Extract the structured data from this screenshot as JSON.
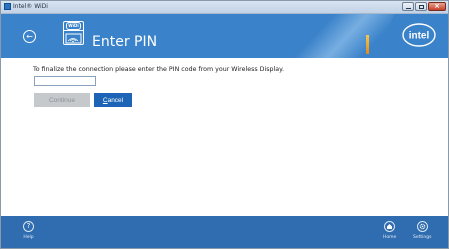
{
  "window": {
    "title": "Intel® WiDi"
  },
  "header": {
    "title": "Enter PIN",
    "widi_logo_text": "WiDi",
    "brand": "intel",
    "colors": {
      "header_blue": "#3a82c9",
      "accent_orange": "#f0a63a"
    }
  },
  "content": {
    "instruction": "To finalize the connection please enter the PIN code from your Wireless Display.",
    "pin_input": {
      "value": "",
      "placeholder": ""
    },
    "continue_label": "Continue",
    "cancel_mnemonic": "C",
    "cancel_rest": "ancel"
  },
  "footer": {
    "help_label": "Help",
    "home_label": "Home",
    "settings_label": "Settings",
    "icons": [
      "question-icon",
      "home-icon",
      "gear-icon"
    ]
  }
}
